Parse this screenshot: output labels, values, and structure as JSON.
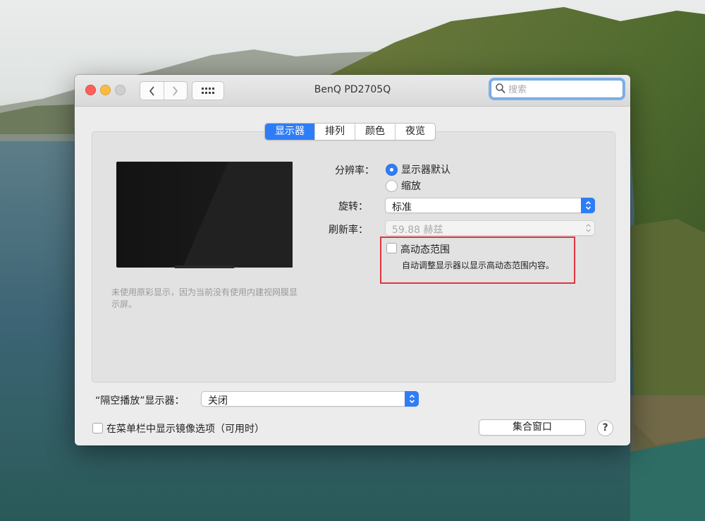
{
  "window": {
    "title": "BenQ PD2705Q",
    "search_placeholder": "搜索"
  },
  "tabs": [
    {
      "label": "显示器",
      "active": true
    },
    {
      "label": "排列",
      "active": false
    },
    {
      "label": "颜色",
      "active": false
    },
    {
      "label": "夜览",
      "active": false
    }
  ],
  "display": {
    "caption": "未使用原彩显示，因为当前没有使用内建视网膜显示屏。",
    "resolution": {
      "label": "分辨率：",
      "options": [
        {
          "label": "显示器默认",
          "selected": true
        },
        {
          "label": "缩放",
          "selected": false
        }
      ]
    },
    "rotation": {
      "label": "旋转：",
      "value": "标准"
    },
    "refresh": {
      "label": "刷新率：",
      "value": "59.88 赫兹",
      "enabled": false
    },
    "hdr": {
      "label": "高动态范围",
      "checked": false,
      "description": "自动调整显示器以显示高动态范围内容。"
    }
  },
  "bottom": {
    "airplay_label": "“隔空播放”显示器：",
    "airplay_value": "关闭",
    "mirror_label": "在菜单栏中显示镜像选项（可用时）",
    "mirror_checked": false,
    "gather_button": "集合窗口",
    "help_button": "?"
  },
  "colors": {
    "accent": "#2f7df6",
    "highlight_box": "#e03441"
  }
}
